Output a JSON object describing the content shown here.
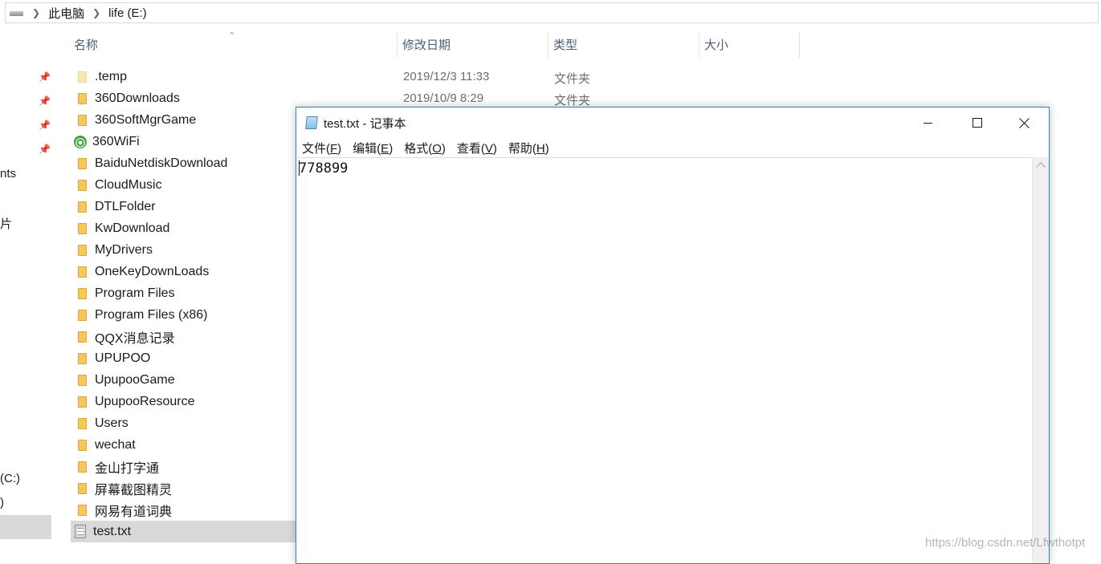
{
  "address_bar": {
    "crumbs": [
      "此电脑",
      "life (E:)"
    ]
  },
  "nav_pane": {
    "fragments": [
      "nts",
      "片",
      "(C:)",
      ")"
    ]
  },
  "columns": {
    "name": "名称",
    "modified": "修改日期",
    "type": "类型",
    "size": "大小"
  },
  "files": [
    {
      "name": ".temp",
      "icon": "folder-light-icon",
      "modified": "2019/12/3 11:33",
      "type": "文件夹"
    },
    {
      "name": "360Downloads",
      "icon": "folder-icon",
      "modified": "2019/10/9 8:29",
      "type": "文件夹"
    },
    {
      "name": "360SoftMgrGame",
      "icon": "folder-icon"
    },
    {
      "name": "360WiFi",
      "icon": "wifi-icon"
    },
    {
      "name": "BaiduNetdiskDownload",
      "icon": "folder-icon"
    },
    {
      "name": "CloudMusic",
      "icon": "folder-icon"
    },
    {
      "name": "DTLFolder",
      "icon": "folder-icon"
    },
    {
      "name": "KwDownload",
      "icon": "folder-icon"
    },
    {
      "name": "MyDrivers",
      "icon": "folder-icon"
    },
    {
      "name": "OneKeyDownLoads",
      "icon": "folder-icon"
    },
    {
      "name": "Program Files",
      "icon": "folder-icon"
    },
    {
      "name": "Program Files (x86)",
      "icon": "folder-icon"
    },
    {
      "name": "QQX消息记录",
      "icon": "folder-icon"
    },
    {
      "name": "UPUPOO",
      "icon": "folder-icon"
    },
    {
      "name": "UpupooGame",
      "icon": "folder-icon"
    },
    {
      "name": "UpupooResource",
      "icon": "folder-icon"
    },
    {
      "name": "Users",
      "icon": "folder-icon"
    },
    {
      "name": "wechat",
      "icon": "folder-icon"
    },
    {
      "name": "金山打字通",
      "icon": "folder-icon"
    },
    {
      "name": "屏幕截图精灵",
      "icon": "folder-icon"
    },
    {
      "name": "网易有道词典",
      "icon": "folder-icon"
    },
    {
      "name": "test.txt",
      "icon": "text-file-icon",
      "selected": true
    }
  ],
  "notepad": {
    "title": "test.txt - 记事本",
    "menus": [
      {
        "label": "文件(",
        "key": "F",
        "end": ")"
      },
      {
        "label": "编辑(",
        "key": "E",
        "end": ")"
      },
      {
        "label": "格式(",
        "key": "O",
        "end": ")"
      },
      {
        "label": "查看(",
        "key": "V",
        "end": ")"
      },
      {
        "label": "帮助(",
        "key": "H",
        "end": ")"
      }
    ],
    "content": "778899"
  },
  "watermark": "https://blog.csdn.net/Lfwthotpt"
}
